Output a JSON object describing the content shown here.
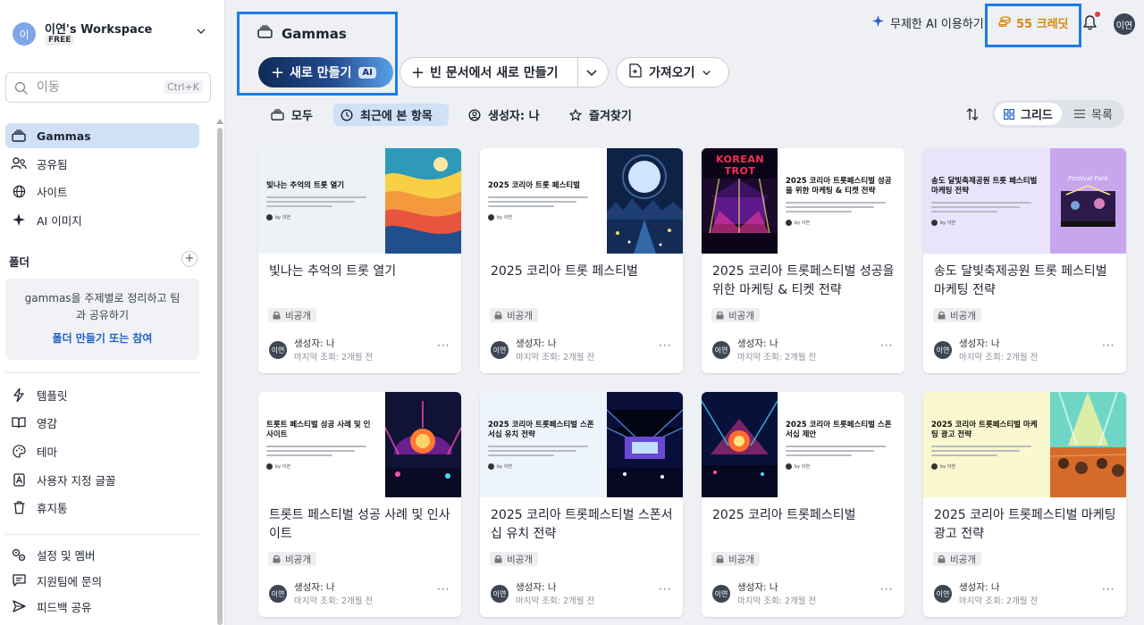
{
  "workspace": {
    "avatar": "이",
    "name": "이연's Workspace",
    "plan": "FREE"
  },
  "search": {
    "placeholder": "이동",
    "shortcut": "Ctrl+K"
  },
  "nav": [
    {
      "label": "Gammas",
      "icon": "gammas-stack-icon"
    },
    {
      "label": "공유됨",
      "icon": "people-icon"
    },
    {
      "label": "사이트",
      "icon": "globe-icon"
    },
    {
      "label": "AI 이미지",
      "icon": "sparkle-icon"
    }
  ],
  "folders": {
    "heading": "폴더",
    "empty_text_1": "gammas을 주제별로 정리하고 팀",
    "empty_text_2": "과 공유하기",
    "link": "폴더 만들기 또는 참여"
  },
  "nav_bottom": [
    {
      "label": "템플릿",
      "icon": "lightning-icon"
    },
    {
      "label": "영감",
      "icon": "book-icon"
    },
    {
      "label": "테마",
      "icon": "palette-icon"
    },
    {
      "label": "사용자 지정 글꼴",
      "icon": "font-icon"
    },
    {
      "label": "휴지통",
      "icon": "trash-icon"
    }
  ],
  "nav_footer": [
    {
      "label": "설정 및 멤버",
      "icon": "settings-icon"
    },
    {
      "label": "지원팀에 문의",
      "icon": "chat-icon"
    },
    {
      "label": "피드백 공유",
      "icon": "send-icon"
    }
  ],
  "header": {
    "title": "Gammas",
    "new_label": "새로 만들기",
    "ai_badge": "AI",
    "blank_label": "빈 문서에서 새로 만들기",
    "import_label": "가져오기",
    "unlimited_ai": "무제한 AI 이용하기",
    "credits": "55 크레딧",
    "user_avatar": "이연"
  },
  "filters": [
    {
      "label": "모두",
      "icon": "stack-icon"
    },
    {
      "label": "최근에 본 항목",
      "icon": "clock-icon"
    },
    {
      "label": "생성자: 나",
      "icon": "user-circle-icon"
    },
    {
      "label": "즐겨찾기",
      "icon": "star-icon"
    }
  ],
  "view": {
    "grid": "그리드",
    "list": "목록"
  },
  "cards": [
    {
      "title": "빛나는 추억의 트롯 열기",
      "thumb_title": "빛나는 추억의 트롯 열기",
      "badge": "비공개",
      "owner": "생성자: 나",
      "viewed": "마지막 조회: 2개월 전",
      "avatar": "이연"
    },
    {
      "title": "2025 코리아 트롯 페스티벌",
      "thumb_title": "2025 코리아 트롯 페스티벌",
      "badge": "비공개",
      "owner": "생성자: 나",
      "viewed": "마지막 조회: 2개월 전",
      "avatar": "이연"
    },
    {
      "title": "2025 코리아 트롯페스티벌 성공을 위한 마케팅 & 티켓 전략",
      "thumb_title": "2025 코리아 트롯페스티벌 성공을 위한 마케팅 & 티켓 전략",
      "thumb_banner": "KOREAN TROT",
      "badge": "비공개",
      "owner": "생성자: 나",
      "viewed": "마지막 조회: 2개월 전",
      "avatar": "이연"
    },
    {
      "title": "송도 달빛축제공원 트롯 페스티벌 마케팅 전략",
      "thumb_title": "송도 달빛축제공원 트롯 페스티벌 마케팅 전략",
      "thumb_poster": "Festival Park",
      "badge": "비공개",
      "owner": "생성자: 나",
      "viewed": "마지막 조회: 2개월 전",
      "avatar": "이연"
    },
    {
      "title": "트롯트 페스티벌 성공 사례 및 인사이트",
      "thumb_title": "트롯트 페스티벌 성공 사례 및 인사이트",
      "badge": "비공개",
      "owner": "생성자: 나",
      "viewed": "마지막 조회: 2개월 전",
      "avatar": "이연"
    },
    {
      "title": "2025 코리아 트롯페스티벌 스폰서십 유치 전략",
      "thumb_title": "2025 코리아 트롯페스티벌 스폰서십 유치 전략",
      "badge": "비공개",
      "owner": "생성자: 나",
      "viewed": "마지막 조회: 2개월 전",
      "avatar": "이연"
    },
    {
      "title": "2025 코리아 트롯페스티벌",
      "thumb_title": "2025 코리아 트롯페스티벌 스폰서십 제안",
      "badge": "비공개",
      "owner": "생성자: 나",
      "viewed": "마지막 조회: 2개월 전",
      "avatar": "이연"
    },
    {
      "title": "2025 코리아 트롯페스티벌 마케팅 광고 전략",
      "thumb_title": "2025 코리아 트롯페스티벌 마케팅 광고 전략",
      "badge": "비공개",
      "owner": "생성자: 나",
      "viewed": "마지막 조회: 2개월 전",
      "avatar": "이연"
    }
  ],
  "thumb_by": "by 이연",
  "colors": {
    "accent": "#1d7be8",
    "active_bg": "#cfe0f7",
    "credit": "#d4880c",
    "link": "#1e63c7"
  }
}
